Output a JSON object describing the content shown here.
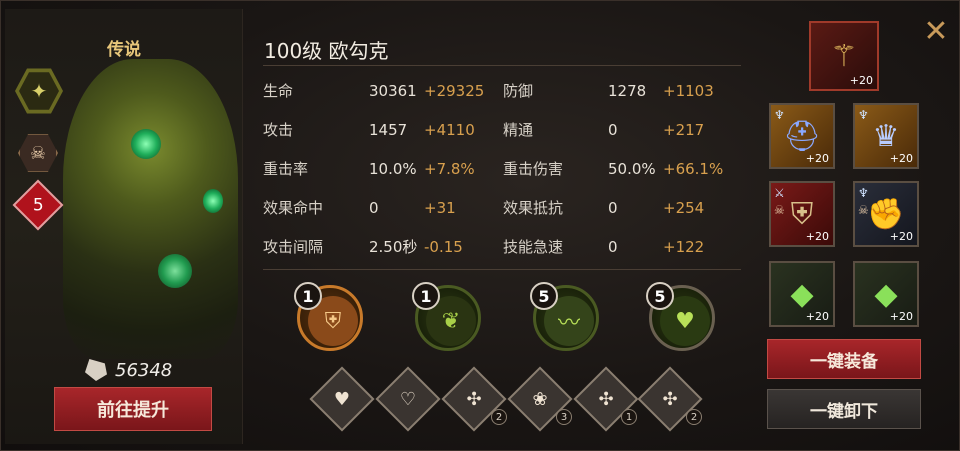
{
  "hero": {
    "rarity": "传说",
    "level_badge": "5",
    "power": "56348",
    "upgrade_button": "前往提升",
    "title": "100级  欧勾克"
  },
  "stats": [
    {
      "n1": "生命",
      "v1": "30361",
      "b1": "+29325",
      "n2": "防御",
      "v2": "1278",
      "b2": "+1103"
    },
    {
      "n1": "攻击",
      "v1": "1457",
      "b1": "+4110",
      "n2": "精通",
      "v2": "0",
      "b2": "+217"
    },
    {
      "n1": "重击率",
      "v1": "10.0%",
      "b1": "+7.8%",
      "n2": "重击伤害",
      "v2": "50.0%",
      "b2": "+66.1%"
    },
    {
      "n1": "效果命中",
      "v1": "0",
      "b1": "+31",
      "n2": "效果抵抗",
      "v2": "0",
      "b2": "+254"
    },
    {
      "n1": "攻击间隔",
      "v1": "2.50秒",
      "b1": "-0.15",
      "n2": "技能急速",
      "v2": "0",
      "b2": "+122"
    }
  ],
  "skills": [
    {
      "badge": "1",
      "icon": "armor-icon",
      "color": "#c87a2a"
    },
    {
      "badge": "1",
      "icon": "spirit-icon",
      "color": "#6a8a2a"
    },
    {
      "badge": "5",
      "icon": "claw-icon",
      "color": "#5a8a2a"
    },
    {
      "badge": "5",
      "icon": "heart-icon",
      "color": "#4a7a22"
    }
  ],
  "runes": [
    {
      "icon": "heart-icon",
      "count": ""
    },
    {
      "icon": "heart-drop-icon",
      "count": ""
    },
    {
      "icon": "sprout-plus-icon",
      "count": "2"
    },
    {
      "icon": "lotus-icon",
      "count": "3"
    },
    {
      "icon": "sprout-plus-icon",
      "count": "1"
    },
    {
      "icon": "sprout-plus-icon",
      "count": "2"
    }
  ],
  "equipment": {
    "weapon": {
      "plus": "+20",
      "icon": "staff-icon"
    },
    "slots": [
      {
        "plus": "+20",
        "icon": "helmet-icon"
      },
      {
        "plus": "+20",
        "icon": "crown-icon"
      },
      {
        "plus": "+20",
        "icon": "chest-armor-icon"
      },
      {
        "plus": "+20",
        "icon": "gauntlet-icon"
      },
      {
        "plus": "+20",
        "icon": "green-gem-icon"
      },
      {
        "plus": "+20",
        "icon": "green-gem-icon"
      }
    ],
    "equip_all": "一键装备",
    "unequip_all": "一键卸下"
  },
  "colors": {
    "accent_gold": "#d8a04e",
    "button_red": "#a8262a"
  }
}
